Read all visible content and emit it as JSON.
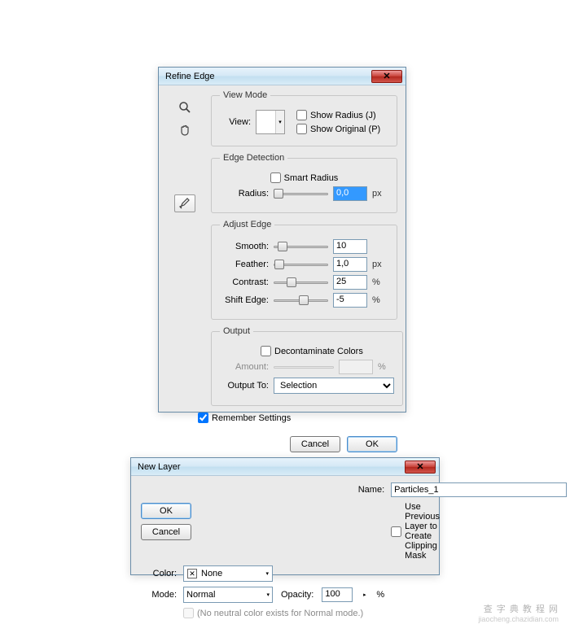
{
  "refine": {
    "title": "Refine Edge",
    "sections": {
      "view_mode": "View Mode",
      "edge_detection": "Edge Detection",
      "adjust_edge": "Adjust Edge",
      "output": "Output"
    },
    "view": {
      "label": "View:",
      "show_radius": "Show Radius (J)",
      "show_original": "Show Original (P)"
    },
    "edge": {
      "smart_radius": "Smart Radius",
      "radius_label": "Radius:",
      "radius_value": "0,0",
      "radius_unit": "px"
    },
    "adjust": {
      "smooth": {
        "label": "Smooth:",
        "value": "10"
      },
      "feather": {
        "label": "Feather:",
        "value": "1,0",
        "unit": "px"
      },
      "contrast": {
        "label": "Contrast:",
        "value": "25",
        "unit": "%"
      },
      "shift": {
        "label": "Shift Edge:",
        "value": "-5",
        "unit": "%"
      }
    },
    "output": {
      "decontaminate": "Decontaminate Colors",
      "amount_label": "Amount:",
      "amount_unit": "%",
      "output_to_label": "Output To:",
      "output_to_value": "Selection"
    },
    "remember": "Remember Settings",
    "buttons": {
      "cancel": "Cancel",
      "ok": "OK"
    }
  },
  "newlayer": {
    "title": "New Layer",
    "name_label": "Name:",
    "name_value": "Particles_1",
    "clip_label": "Use Previous Layer to Create Clipping Mask",
    "color_label": "Color:",
    "color_value": "None",
    "mode_label": "Mode:",
    "mode_value": "Normal",
    "opacity_label": "Opacity:",
    "opacity_value": "100",
    "opacity_unit": "%",
    "neutral_label": "(No neutral color exists for Normal mode.)",
    "buttons": {
      "ok": "OK",
      "cancel": "Cancel"
    }
  },
  "watermark": {
    "line1": "查 字 典 教 程 网",
    "line2": "jiaocheng.chazidian.com"
  }
}
